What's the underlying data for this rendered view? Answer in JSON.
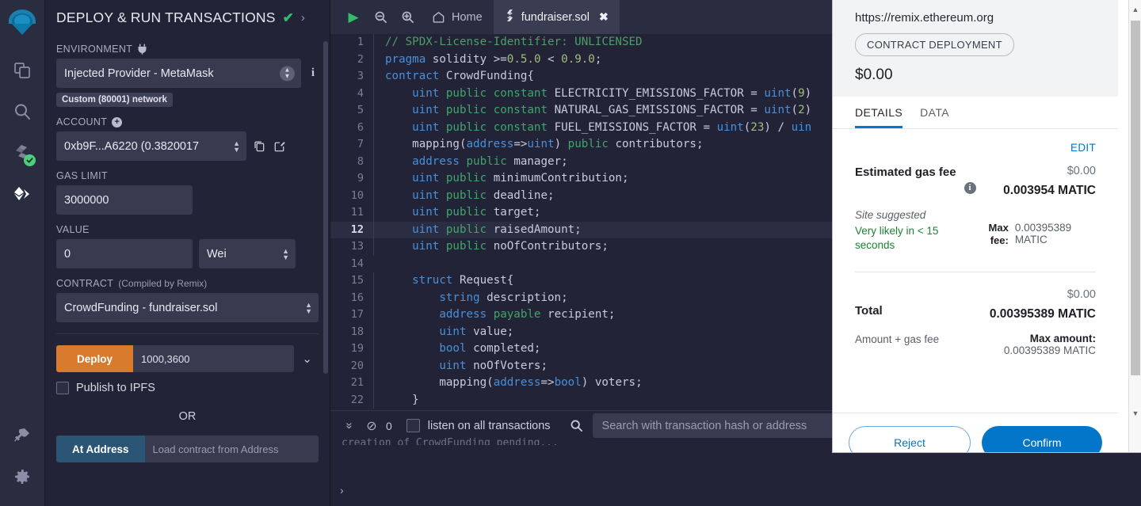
{
  "rail": {
    "items": [
      {
        "name": "remix-logo",
        "label": "Remix"
      },
      {
        "name": "file-explorer-icon",
        "label": "File explorers"
      },
      {
        "name": "search-icon",
        "label": "Search in files"
      },
      {
        "name": "solidity-compiler-icon",
        "label": "Solidity compiler"
      },
      {
        "name": "deploy-run-icon",
        "label": "Deploy & run transactions"
      },
      {
        "name": "plugin-manager-icon",
        "label": "Plugin manager"
      },
      {
        "name": "settings-gear-icon",
        "label": "Settings"
      }
    ]
  },
  "panel": {
    "title": "DEPLOY & RUN TRANSACTIONS",
    "check_glyph": "✔",
    "chevron_glyph": "›",
    "environment": {
      "label": "ENVIRONMENT",
      "value": "Injected Provider - MetaMask",
      "network_pill": "Custom (80001) network",
      "info_glyph": "i"
    },
    "account": {
      "label": "ACCOUNT",
      "plus_glyph": "+",
      "value": "0xb9F...A6220 (0.3820017 "
    },
    "gas_limit": {
      "label": "GAS LIMIT",
      "value": "3000000"
    },
    "value_field": {
      "label": "VALUE",
      "value": "0",
      "unit": "Wei"
    },
    "contract": {
      "label": "CONTRACT",
      "sub": "(Compiled by Remix)",
      "value": "CrowdFunding - fundraiser.sol"
    },
    "deploy": {
      "button": "Deploy",
      "args": "1000,3600",
      "caret_glyph": "⌄"
    },
    "ipfs": {
      "label": "Publish to IPFS"
    },
    "or": "OR",
    "at_address": {
      "button": "At Address",
      "placeholder": "Load contract from Address"
    }
  },
  "editor": {
    "toolbar": {
      "run_glyph": "▶",
      "zoom_out": "zoom-out",
      "zoom_in": "zoom-in",
      "home": "Home"
    },
    "tab": {
      "name": "fundraiser.sol",
      "close_glyph": "✖"
    },
    "highlight_line": 12,
    "lines": [
      {
        "n": 1,
        "html": "<span class=\"k-com\">// SPDX-License-Identifier: UNLICENSED</span>"
      },
      {
        "n": 2,
        "html": "<span class=\"k-kw\">pragma</span> <span class=\"k-plain\">solidity</span> <span class=\"k-plain\">&gt;=</span><span class=\"k-num\">0.5.0</span> <span class=\"k-plain\">&lt;</span> <span class=\"k-num\">0.9.0</span><span class=\"k-plain\">;</span>"
      },
      {
        "n": 3,
        "html": "<span class=\"k-kw\">contract</span> <span class=\"k-plain\">CrowdFunding{</span>"
      },
      {
        "n": 4,
        "html": "    <span class=\"k-type\">uint</span> <span class=\"k-kw2\">public</span> <span class=\"k-kw2\">constant</span> <span class=\"k-plain\">ELECTRICITY_EMISSIONS_FACTOR = </span><span class=\"k-type\">uint</span><span class=\"k-plain\">(</span><span class=\"k-num\">9</span><span class=\"k-plain\">)</span>"
      },
      {
        "n": 5,
        "html": "    <span class=\"k-type\">uint</span> <span class=\"k-kw2\">public</span> <span class=\"k-kw2\">constant</span> <span class=\"k-plain\">NATURAL_GAS_EMISSIONS_FACTOR = </span><span class=\"k-type\">uint</span><span class=\"k-plain\">(</span><span class=\"k-num\">2</span><span class=\"k-plain\">)</span>"
      },
      {
        "n": 6,
        "html": "    <span class=\"k-type\">uint</span> <span class=\"k-kw2\">public</span> <span class=\"k-kw2\">constant</span> <span class=\"k-plain\">FUEL_EMISSIONS_FACTOR = </span><span class=\"k-type\">uint</span><span class=\"k-plain\">(</span><span class=\"k-num\">23</span><span class=\"k-plain\">) / </span><span class=\"k-type\">uin</span>"
      },
      {
        "n": 7,
        "html": "    <span class=\"k-plain\">mapping(</span><span class=\"k-type\">address</span><span class=\"k-plain\">=&gt;</span><span class=\"k-type\">uint</span><span class=\"k-plain\">) </span><span class=\"k-kw2\">public</span> <span class=\"k-plain\">contributors;</span>"
      },
      {
        "n": 8,
        "html": "    <span class=\"k-type\">address</span> <span class=\"k-kw2\">public</span> <span class=\"k-plain\">manager;</span>"
      },
      {
        "n": 9,
        "html": "    <span class=\"k-type\">uint</span> <span class=\"k-kw2\">public</span> <span class=\"k-plain\">minimumContribution;</span>"
      },
      {
        "n": 10,
        "html": "    <span class=\"k-type\">uint</span> <span class=\"k-kw2\">public</span> <span class=\"k-plain\">deadline;</span>"
      },
      {
        "n": 11,
        "html": "    <span class=\"k-type\">uint</span> <span class=\"k-kw2\">public</span> <span class=\"k-plain\">target;</span>"
      },
      {
        "n": 12,
        "html": "    <span class=\"k-type\">uint</span> <span class=\"k-kw2\">public</span> <span class=\"k-plain\">raisedAmount;</span>"
      },
      {
        "n": 13,
        "html": "    <span class=\"k-type\">uint</span> <span class=\"k-kw2\">public</span> <span class=\"k-plain\">noOfContributors;</span>"
      },
      {
        "n": 14,
        "html": ""
      },
      {
        "n": 15,
        "html": "    <span class=\"k-kw\">struct</span> <span class=\"k-plain\">Request{</span>"
      },
      {
        "n": 16,
        "html": "        <span class=\"k-type\">string</span> <span class=\"k-plain\">description;</span>"
      },
      {
        "n": 17,
        "html": "        <span class=\"k-type\">address</span> <span class=\"k-kw2\">payable</span> <span class=\"k-plain\">recipient;</span>"
      },
      {
        "n": 18,
        "html": "        <span class=\"k-type\">uint</span> <span class=\"k-plain\">value;</span>"
      },
      {
        "n": 19,
        "html": "        <span class=\"k-type\">bool</span> <span class=\"k-plain\">completed;</span>"
      },
      {
        "n": 20,
        "html": "        <span class=\"k-type\">uint</span> <span class=\"k-plain\">noOfVoters;</span>"
      },
      {
        "n": 21,
        "html": "        <span class=\"k-plain\">mapping(</span><span class=\"k-type\">address</span><span class=\"k-plain\">=&gt;</span><span class=\"k-type\">bool</span><span class=\"k-plain\">) voters;</span>"
      },
      {
        "n": 22,
        "html": "    <span class=\"k-plain\">}</span>"
      }
    ]
  },
  "terminal": {
    "collapse_glyph": "»",
    "clear_glyph": "⊘",
    "count": "0",
    "listen_label": "listen on all transactions",
    "search_placeholder": "Search with transaction hash or address",
    "log": "creation of CrowdFunding pending...",
    "prompt_glyph": "›"
  },
  "metamask": {
    "url": "https://remix.ethereum.org",
    "pill": "CONTRACT DEPLOYMENT",
    "amount": "$0.00",
    "tabs": [
      {
        "label": "DETAILS",
        "active": true
      },
      {
        "label": "DATA",
        "active": false
      }
    ],
    "edit_label": "EDIT",
    "gas": {
      "title": "Estimated gas fee",
      "info_glyph": "i",
      "fiat": "$0.00",
      "native": "0.003954 MATIC",
      "site_suggested": "Site suggested",
      "speed": "Very likely in < 15 seconds",
      "max_fee_label": "Max fee:",
      "max_fee_value": "0.00395389 MATIC"
    },
    "total": {
      "label": "Total",
      "fiat": "$0.00",
      "native": "0.00395389 MATIC",
      "amount_label": "Amount + gas fee",
      "max_amount_label": "Max amount:",
      "max_amount_value": "0.00395389 MATIC"
    },
    "buttons": {
      "reject": "Reject",
      "confirm": "Confirm"
    },
    "scroll": {
      "up_glyph": "▲",
      "down_glyph": "▼"
    }
  },
  "colors": {
    "accent_orange": "#d97b2c",
    "accent_blue": "#0376c9",
    "success_green": "#1c8234",
    "panel_bg": "#222336",
    "rail_bg": "#2a2c3f"
  }
}
